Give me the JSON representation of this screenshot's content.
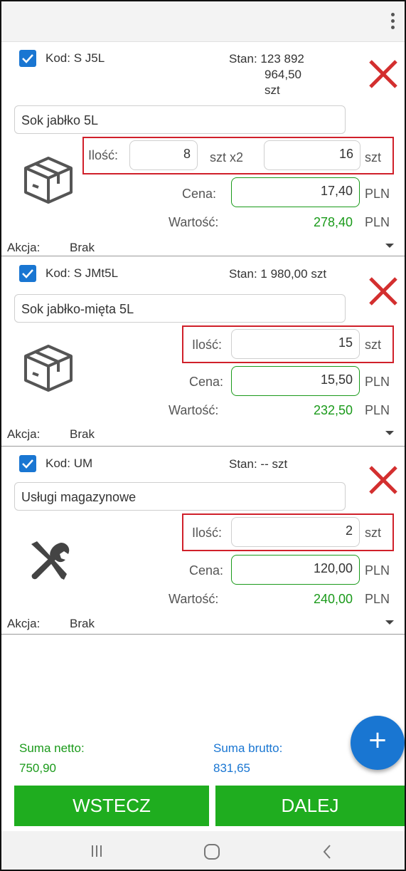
{
  "menu_icon": "more-vertical-icon",
  "items": [
    {
      "kod": "Kod: S J5L",
      "stan_lines": [
        "Stan: 123 892",
        "964,50",
        "szt"
      ],
      "name": "Sok jabłko 5L",
      "icon": "package-box-icon",
      "qty_label": "Ilość:",
      "qty": "8",
      "qty_unit": "szt x2",
      "qty2": "16",
      "qty2_unit": "szt",
      "price_label": "Cena:",
      "price": "17,40",
      "price_unit": "PLN",
      "value_label": "Wartość:",
      "value": "278,40",
      "value_unit": "PLN",
      "akcja_label": "Akcja:",
      "akcja_value": "Brak"
    },
    {
      "kod": "Kod: S JMt5L",
      "stan_lines": [
        "Stan: 1 980,00 szt"
      ],
      "name": "Sok jabłko-mięta 5L",
      "icon": "package-box-icon",
      "qty_label": "Ilość:",
      "qty": "15",
      "qty_unit": "szt",
      "price_label": "Cena:",
      "price": "15,50",
      "price_unit": "PLN",
      "value_label": "Wartość:",
      "value": "232,50",
      "value_unit": "PLN",
      "akcja_label": "Akcja:",
      "akcja_value": "Brak"
    },
    {
      "kod": "Kod: UM",
      "stan_lines": [
        "Stan: -- szt"
      ],
      "name": "Usługi magazynowe",
      "icon": "tools-wrench-screwdriver-icon",
      "qty_label": "Ilość:",
      "qty": "2",
      "qty_unit": "szt",
      "price_label": "Cena:",
      "price": "120,00",
      "price_unit": "PLN",
      "value_label": "Wartość:",
      "value": "240,00",
      "value_unit": "PLN",
      "akcja_label": "Akcja:",
      "akcja_value": "Brak"
    }
  ],
  "totals": {
    "netto_label": "Suma netto:",
    "netto_value": "750,90",
    "brutto_label": "Suma brutto:",
    "brutto_value": "831,65"
  },
  "fab_label": "+",
  "buttons": {
    "back": "WSTECZ",
    "next": "DALEJ"
  },
  "colors": {
    "accent_blue": "#1976d2",
    "green": "#1fad1f",
    "value_green": "#1a9a1a",
    "delete_red": "#d32f2f",
    "highlight_red": "#d0202a"
  },
  "navbar": {
    "recent": "recent-apps-icon",
    "home": "home-icon",
    "back": "back-icon"
  }
}
